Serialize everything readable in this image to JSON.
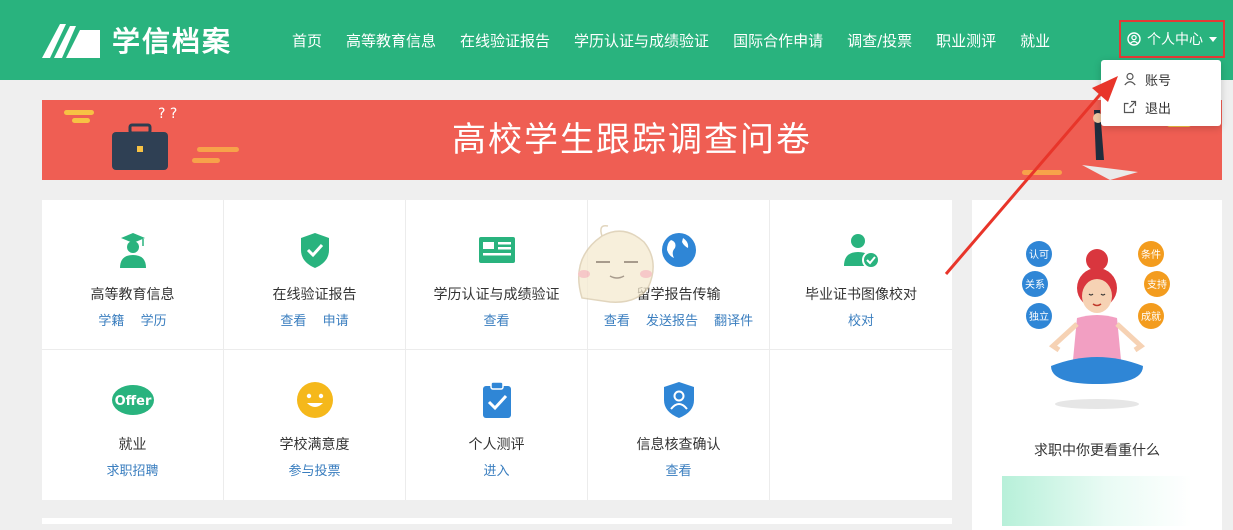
{
  "header": {
    "logo_text": "学信档案",
    "nav": [
      "首页",
      "高等教育信息",
      "在线验证报告",
      "学历认证与成绩验证",
      "国际合作申请",
      "调查/投票",
      "职业测评",
      "就业"
    ],
    "user_menu_label": "个人中心"
  },
  "dropdown": {
    "items": [
      "账号",
      "退出"
    ]
  },
  "banner": {
    "title": "高校学生跟踪调查问卷"
  },
  "services": [
    {
      "title": "高等教育信息",
      "links": [
        "学籍",
        "学历"
      ]
    },
    {
      "title": "在线验证报告",
      "links": [
        "查看",
        "申请"
      ]
    },
    {
      "title": "学历认证与成绩验证",
      "links": [
        "查看"
      ]
    },
    {
      "title": "留学报告传输",
      "links": [
        "查看",
        "发送报告",
        "翻译件"
      ]
    },
    {
      "title": "毕业证书图像校对",
      "links": [
        "校对"
      ]
    },
    {
      "title": "就业",
      "links": [
        "求职招聘"
      ],
      "icon_text": "Offer"
    },
    {
      "title": "学校满意度",
      "links": [
        "参与投票"
      ]
    },
    {
      "title": "个人测评",
      "links": [
        "进入"
      ]
    },
    {
      "title": "信息核查确认",
      "links": [
        "查看"
      ]
    }
  ],
  "sidebar": {
    "caption": "求职中你更看重什么",
    "bubbles": [
      "认可",
      "关系",
      "独立",
      "条件",
      "支持",
      "成就"
    ]
  },
  "colors": {
    "header": "#29b37e",
    "banner": "#ef5e53",
    "link": "#3a7ebf",
    "highlight": "#e53935"
  }
}
